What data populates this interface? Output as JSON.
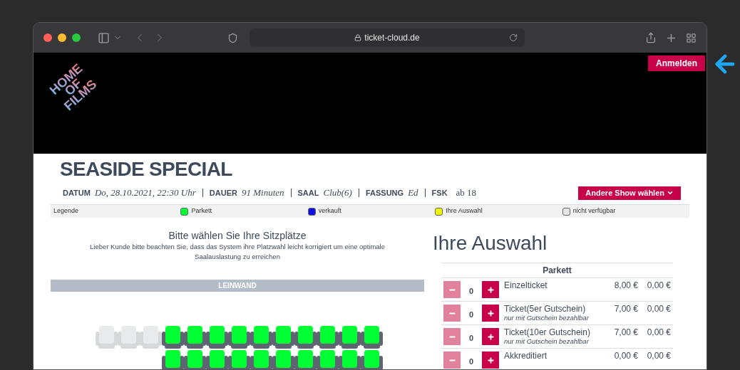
{
  "browser": {
    "url": "ticket-cloud.de"
  },
  "header": {
    "logo_lines": [
      "HOME",
      "OF",
      "FILMS"
    ],
    "login_button": "Anmelden"
  },
  "event": {
    "title": "SEASIDE SPECIAL",
    "info": [
      {
        "label": "DATUM",
        "value": "Do, 28.10.2021, 22:30 Uhr",
        "italic": true
      },
      {
        "label": "DAUER",
        "value": "91 Minuten",
        "italic": true
      },
      {
        "label": "SAAL",
        "value": "Club(6)",
        "italic": true
      },
      {
        "label": "FASSUNG",
        "value": "Ed",
        "italic": true
      },
      {
        "label": "FSK",
        "value": "ab 18",
        "italic": false
      }
    ],
    "other_show_button": "Andere Show wählen"
  },
  "legend": {
    "label": "Legende",
    "items": [
      {
        "label": "Parkett",
        "color": "#00ff33"
      },
      {
        "label": "verkauft",
        "color": "#1010e0"
      },
      {
        "label": "Ihre Auswahl",
        "color": "#f5f500"
      },
      {
        "label": "nicht verfügbar",
        "color": "#e4e6e8"
      }
    ]
  },
  "seat_plan": {
    "heading": "Bitte wählen Sie Ihre Sitzplätze",
    "note": "Lieber Kunde bitte beachten Sie, dass das System ihre Platzwahl leicht korrigiert um eine optimale Saalauslastung zu erreichen",
    "screen_label": "LEINWAND",
    "rows": [
      {
        "seats": [
          {
            "kind": "unavailable"
          },
          {
            "kind": "unavailable"
          },
          {
            "kind": "unavailable"
          },
          {
            "kind": "available"
          },
          {
            "kind": "available"
          },
          {
            "kind": "available"
          },
          {
            "kind": "available"
          },
          {
            "kind": "available"
          },
          {
            "kind": "available"
          },
          {
            "kind": "available"
          },
          {
            "kind": "available"
          },
          {
            "kind": "available"
          },
          {
            "kind": "available"
          }
        ]
      },
      {
        "seats": [
          {
            "kind": "gap"
          },
          {
            "kind": "gap"
          },
          {
            "kind": "gap"
          },
          {
            "kind": "available"
          },
          {
            "kind": "available"
          },
          {
            "kind": "available"
          },
          {
            "kind": "available"
          },
          {
            "kind": "available"
          },
          {
            "kind": "available"
          },
          {
            "kind": "available"
          },
          {
            "kind": "available"
          },
          {
            "kind": "available"
          },
          {
            "kind": "available"
          }
        ]
      }
    ]
  },
  "selection": {
    "title": "Ihre Auswahl",
    "section": "Parkett",
    "tickets": [
      {
        "name": "Einzelticket",
        "quantity": "0",
        "price": "8,00 €",
        "total": "0,00 €",
        "minus_disabled": true
      },
      {
        "name": "Ticket(5er Gutschein)",
        "note": "nur mit Gutschein bezahlbar",
        "quantity": "0",
        "price": "7,00 €",
        "total": "0,00 €",
        "minus_disabled": true
      },
      {
        "name": "Ticket(10er Gutschein)",
        "note": "nur mit Gutschein bezahlbar",
        "quantity": "0",
        "price": "7,00 €",
        "total": "0,00 €",
        "minus_disabled": true
      },
      {
        "name": "Akkreditiert",
        "quantity": "0",
        "price": "0,00 €",
        "total": "0,00 €",
        "minus_disabled": true
      }
    ]
  }
}
